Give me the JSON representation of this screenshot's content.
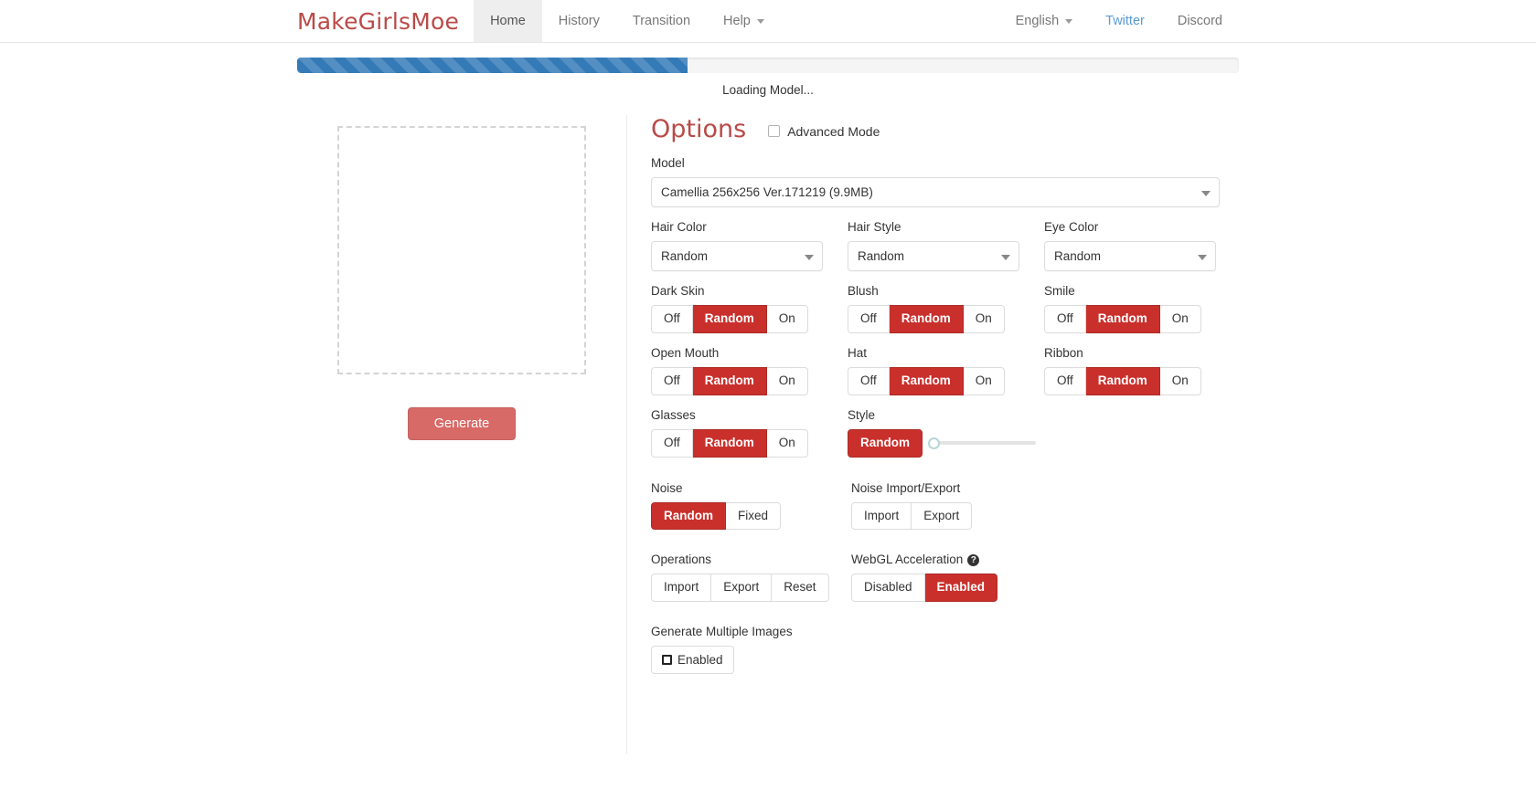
{
  "nav": {
    "brand": "MakeGirlsMoe",
    "items": [
      {
        "label": "Home",
        "active": true
      },
      {
        "label": "History",
        "active": false
      },
      {
        "label": "Transition",
        "active": false
      },
      {
        "label": "Help",
        "active": false,
        "caret": true
      }
    ],
    "right": [
      {
        "label": "English",
        "caret": true,
        "style": "muted"
      },
      {
        "label": "Twitter",
        "style": "link"
      },
      {
        "label": "Discord",
        "style": "muted"
      }
    ],
    "brand_color": "#b94a48",
    "link_color": "#5b9bd5"
  },
  "progress": {
    "percent": 41.5,
    "status_text": "Loading Model...",
    "bar_color": "#337ab7"
  },
  "preview": {
    "generate_label": "Generate",
    "generate_color": "#c9302c"
  },
  "options": {
    "title": "Options",
    "advanced_mode_label": "Advanced Mode",
    "advanced_mode_checked": false,
    "model": {
      "label": "Model",
      "value": "Camellia 256x256 Ver.171219 (9.9MB)"
    },
    "selects": [
      {
        "label": "Hair Color",
        "value": "Random"
      },
      {
        "label": "Hair Style",
        "value": "Random"
      },
      {
        "label": "Eye Color",
        "value": "Random"
      }
    ],
    "toggles_row1": [
      {
        "label": "Dark Skin",
        "buttons": [
          "Off",
          "Random",
          "On"
        ],
        "active": 1
      },
      {
        "label": "Blush",
        "buttons": [
          "Off",
          "Random",
          "On"
        ],
        "active": 1
      },
      {
        "label": "Smile",
        "buttons": [
          "Off",
          "Random",
          "On"
        ],
        "active": 1
      }
    ],
    "toggles_row2": [
      {
        "label": "Open Mouth",
        "buttons": [
          "Off",
          "Random",
          "On"
        ],
        "active": 1
      },
      {
        "label": "Hat",
        "buttons": [
          "Off",
          "Random",
          "On"
        ],
        "active": 1
      },
      {
        "label": "Ribbon",
        "buttons": [
          "Off",
          "Random",
          "On"
        ],
        "active": 1
      }
    ],
    "glasses": {
      "label": "Glasses",
      "buttons": [
        "Off",
        "Random",
        "On"
      ],
      "active": 1
    },
    "style": {
      "label": "Style",
      "button_label": "Random",
      "slider_value": 0,
      "slider_min": 0,
      "slider_max": 100
    },
    "noise": {
      "label": "Noise",
      "buttons": [
        "Random",
        "Fixed"
      ],
      "active": 0
    },
    "noise_io": {
      "label": "Noise Import/Export",
      "buttons": [
        "Import",
        "Export"
      ],
      "active": -1
    },
    "operations": {
      "label": "Operations",
      "buttons": [
        "Import",
        "Export",
        "Reset"
      ],
      "active": -1
    },
    "webgl": {
      "label": "WebGL Acceleration",
      "help_glyph": "?",
      "buttons": [
        "Disabled",
        "Enabled"
      ],
      "active": 1
    },
    "multi": {
      "label": "Generate Multiple Images",
      "button_label": "Enabled",
      "checked": false
    },
    "accent_color": "#c9302c"
  }
}
